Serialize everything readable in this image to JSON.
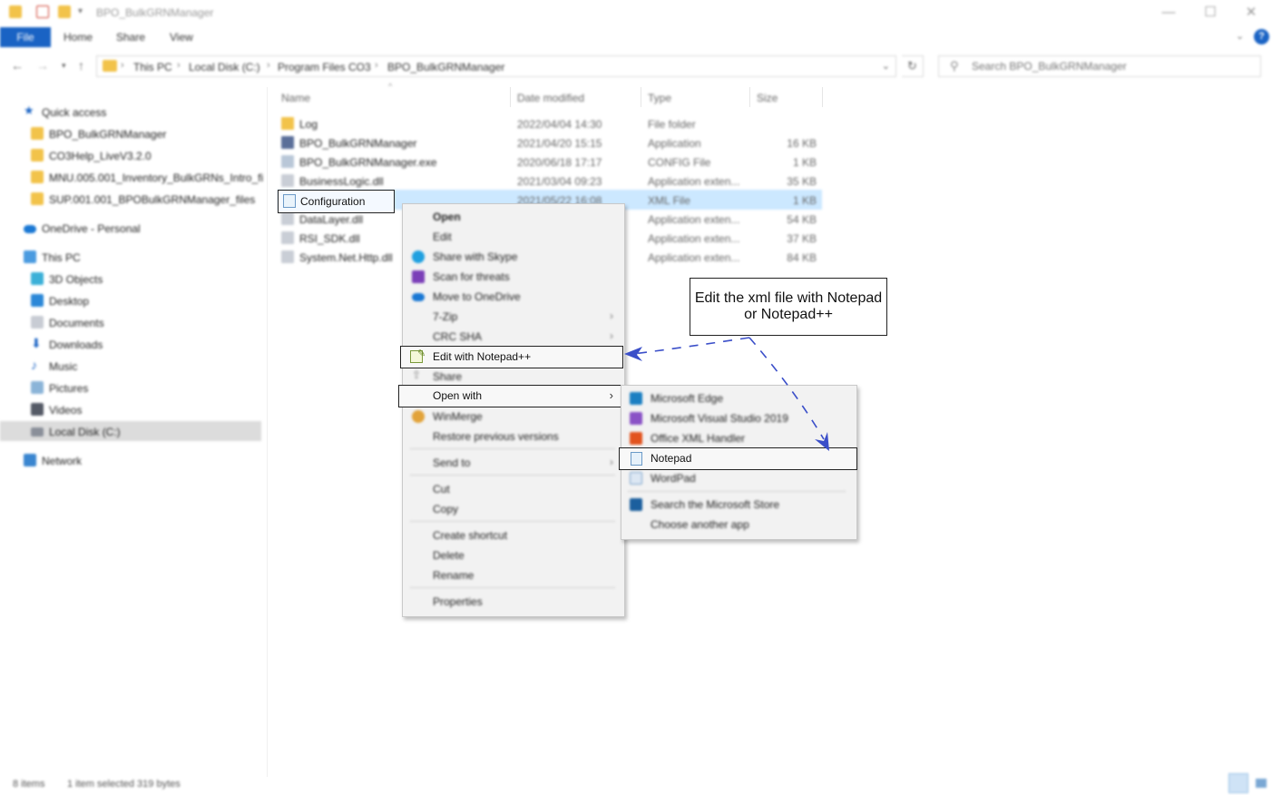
{
  "window": {
    "title": "BPO_BulkGRNManager"
  },
  "ribbon": {
    "file": "File",
    "tabs": [
      "Home",
      "Share",
      "View"
    ],
    "help": "?"
  },
  "address": {
    "crumbs": [
      "This PC",
      "Local Disk (C:)",
      "Program Files CO3",
      "BPO_BulkGRNManager"
    ],
    "search_placeholder": "Search BPO_BulkGRNManager"
  },
  "nav_pane": {
    "quick_access": "Quick access",
    "quick_items": [
      "BPO_BulkGRNManager",
      "CO3Help_LiveV3.2.0",
      "MNU.005.001_Inventory_BulkGRNs_Intro_files",
      "SUP.001.001_BPOBulkGRNManager_files"
    ],
    "onedrive": "OneDrive - Personal",
    "this_pc": "This PC",
    "pc_items": [
      "3D Objects",
      "Desktop",
      "Documents",
      "Downloads",
      "Music",
      "Pictures",
      "Videos",
      "Local Disk (C:)"
    ],
    "network": "Network"
  },
  "columns": {
    "name": "Name",
    "date": "Date modified",
    "type": "Type",
    "size": "Size"
  },
  "files": [
    {
      "name": "Log",
      "date": "2022/04/04 14:30",
      "type": "File folder",
      "size": ""
    },
    {
      "name": "BPO_BulkGRNManager",
      "date": "2021/04/20 15:15",
      "type": "Application",
      "size": "16 KB"
    },
    {
      "name": "BPO_BulkGRNManager.exe",
      "date": "2020/06/18 17:17",
      "type": "CONFIG File",
      "size": "1 KB"
    },
    {
      "name": "BusinessLogic.dll",
      "date": "2021/03/04 09:23",
      "type": "Application exten...",
      "size": "35 KB"
    },
    {
      "name": "Configuration",
      "date": "2021/05/22 16:08",
      "type": "XML File",
      "size": "1 KB"
    },
    {
      "name": "DataLayer.dll",
      "date": "",
      "type": "Application exten...",
      "size": "54 KB"
    },
    {
      "name": "RSI_SDK.dll",
      "date": "",
      "type": "Application exten...",
      "size": "37 KB"
    },
    {
      "name": "System.Net.Http.dll",
      "date": "",
      "type": "Application exten...",
      "size": "84 KB"
    }
  ],
  "context_menu": {
    "open": "Open",
    "edit": "Edit",
    "share_skype": "Share with Skype",
    "scan": "Scan for threats",
    "onedrive": "Move to OneDrive",
    "zip": "7-Zip",
    "crc": "CRC SHA",
    "notepadpp": "Edit with Notepad++",
    "share": "Share",
    "open_with": "Open with",
    "winmerge": "WinMerge",
    "restore": "Restore previous versions",
    "send_to": "Send to",
    "cut": "Cut",
    "copy": "Copy",
    "create_shortcut": "Create shortcut",
    "delete": "Delete",
    "rename": "Rename",
    "properties": "Properties"
  },
  "submenu": {
    "edge": "Microsoft Edge",
    "vs": "Microsoft Visual Studio 2019",
    "office_xml": "Office XML Handler",
    "notepad": "Notepad",
    "wordpad": "WordPad",
    "store": "Search the Microsoft Store",
    "choose": "Choose another app"
  },
  "annotation": {
    "line1": "Edit the xml file with Notepad",
    "line2": "or Notepad++"
  },
  "status": {
    "items": "8 items",
    "selected": "1 item selected 319 bytes"
  },
  "colors": {
    "accent": "#1a63c4",
    "selection": "#cce8ff",
    "arrow": "#3b4fc9",
    "folder": "#f2c34a"
  }
}
